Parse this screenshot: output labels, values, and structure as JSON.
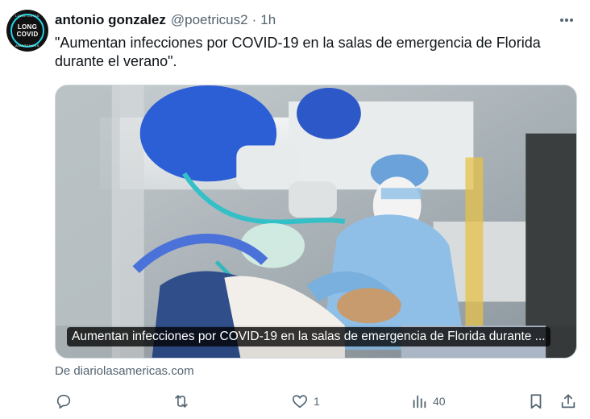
{
  "author": {
    "display_name": "antonio gonzalez",
    "handle": "@poetricus2",
    "separator": "·",
    "time": "1h",
    "avatar": {
      "top_text": "LONG COVID",
      "main_line1": "LONG",
      "main_line2": "COVID",
      "bottom_text": "AWARENESS"
    }
  },
  "tweet": {
    "text": "\"Aumentan infecciones por COVID-19 en la salas de emergencia de Florida durante el verano\"."
  },
  "media": {
    "caption": "Aumentan infecciones por COVID-19 en la salas de emergencia de Florida durante ..."
  },
  "source": {
    "text": "De diariolasamericas.com"
  },
  "actions": {
    "reply": {
      "icon": "reply-icon",
      "count": ""
    },
    "retweet": {
      "icon": "retweet-icon",
      "count": ""
    },
    "like": {
      "icon": "heart-icon",
      "count": "1"
    },
    "views": {
      "icon": "views-icon",
      "count": "40"
    },
    "bookmark": {
      "icon": "bookmark-icon"
    },
    "share": {
      "icon": "share-icon"
    }
  },
  "colors": {
    "text_primary": "#0f1419",
    "text_secondary": "#536471",
    "card_border": "#cfd9de"
  }
}
